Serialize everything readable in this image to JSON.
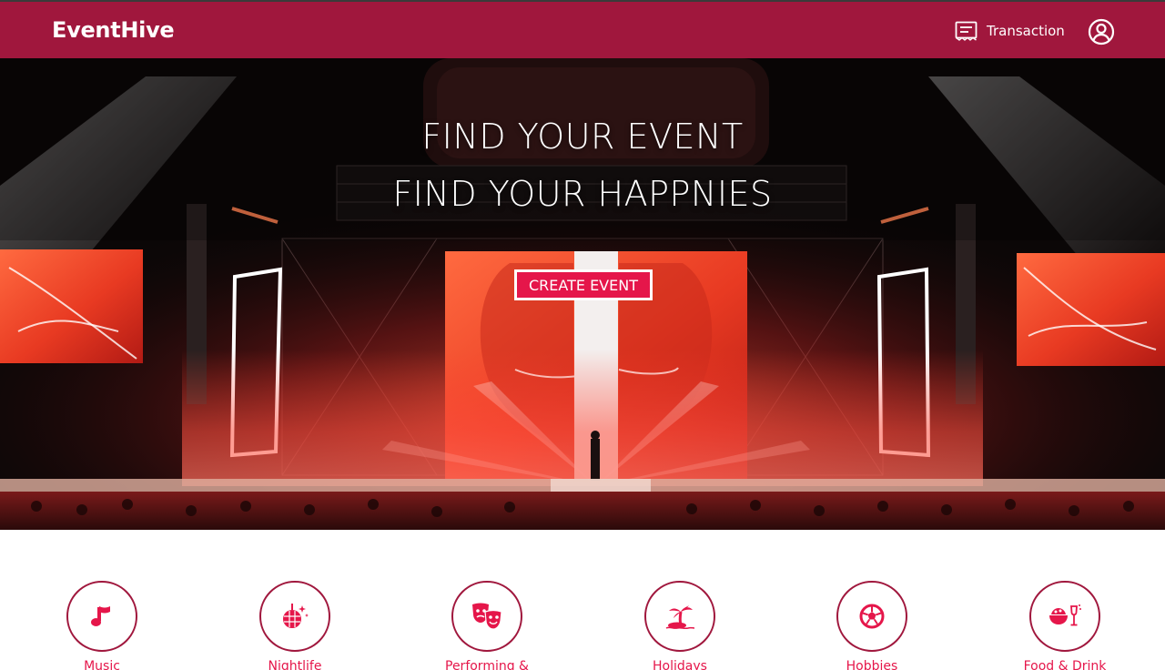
{
  "app": {
    "brand": "EventHive"
  },
  "nav": {
    "transaction_label": "Transaction"
  },
  "hero": {
    "line1": "FIND YOUR EVENT",
    "line2": "FIND YOUR HAPPNIES",
    "cta_label": "CREATE EVENT"
  },
  "categories": [
    {
      "label": "Music",
      "icon": "music-note-icon"
    },
    {
      "label": "Nightlife",
      "icon": "disco-ball-icon"
    },
    {
      "label": "Performing &",
      "icon": "theater-masks-icon"
    },
    {
      "label": "Holidays",
      "icon": "island-icon"
    },
    {
      "label": "Hobbies",
      "icon": "soccer-ball-icon"
    },
    {
      "label": "Food & Drink",
      "icon": "food-drink-icon"
    }
  ],
  "colors": {
    "primary": "#a0173d",
    "accent": "#e5164a"
  }
}
